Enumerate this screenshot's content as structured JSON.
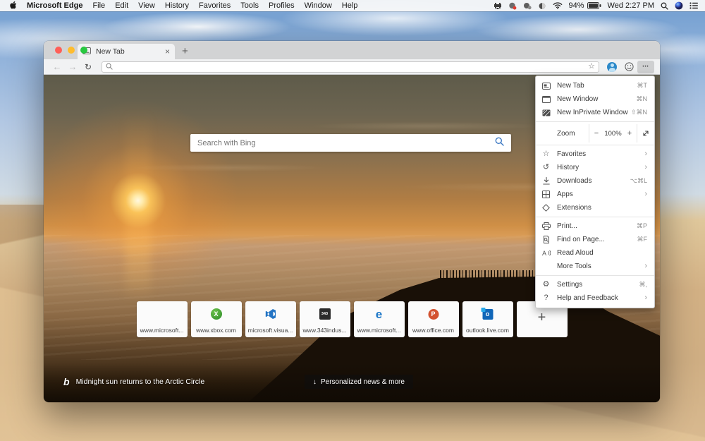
{
  "colors": {
    "accent": "#0078d4",
    "traffic_red": "#ff5f57",
    "traffic_yellow": "#febc2e",
    "traffic_green": "#28c840"
  },
  "icons": {
    "back": "←",
    "forward": "→",
    "reload": "↻",
    "star": "☆",
    "ellipsis": "•••",
    "close": "×",
    "new_tab_plus": "+",
    "add_tile_plus": "+",
    "history": "↺",
    "favorites_star": "☆",
    "gear": "⚙",
    "help": "?",
    "news_arrow": "↓",
    "bing_b": "b"
  },
  "menubar": {
    "app_name": "Microsoft Edge",
    "items": [
      "File",
      "Edit",
      "View",
      "History",
      "Favorites",
      "Tools",
      "Profiles",
      "Window",
      "Help"
    ],
    "status": {
      "battery_percent": "94%",
      "clock": "Wed 2:27 PM"
    }
  },
  "window": {
    "tab": {
      "title": "New Tab"
    },
    "address_value": ""
  },
  "edge_menu": {
    "g1": [
      {
        "label": "New Tab",
        "shortcut": "⌘T"
      },
      {
        "label": "New Window",
        "shortcut": "⌘N"
      },
      {
        "label": "New InPrivate Window",
        "shortcut": "⇧⌘N"
      }
    ],
    "zoom": {
      "label": "Zoom",
      "minus": "−",
      "value": "100%",
      "plus": "+"
    },
    "g2": [
      {
        "label": "Favorites",
        "chevron": "›"
      },
      {
        "label": "History",
        "chevron": "›"
      },
      {
        "label": "Downloads",
        "shortcut": "⌥⌘L"
      },
      {
        "label": "Apps",
        "chevron": "›"
      },
      {
        "label": "Extensions"
      }
    ],
    "g3": [
      {
        "label": "Print...",
        "shortcut": "⌘P"
      },
      {
        "label": "Find on Page...",
        "shortcut": "⌘F"
      },
      {
        "label": "Read Aloud"
      },
      {
        "label": "More Tools",
        "chevron": "›"
      }
    ],
    "g4": [
      {
        "label": "Settings",
        "shortcut": "⌘,"
      },
      {
        "label": "Help and Feedback",
        "chevron": "›"
      }
    ]
  },
  "newtab": {
    "search_placeholder": "Search with Bing",
    "tiles": [
      {
        "label": "www.microsoft..."
      },
      {
        "label": "www.xbox.com"
      },
      {
        "label": "microsoft.visua..."
      },
      {
        "label": "www.343indus..."
      },
      {
        "label": "www.microsoft..."
      },
      {
        "label": "www.office.com"
      },
      {
        "label": "outlook.live.com"
      }
    ],
    "tile_343_text": "343",
    "tile_xbox_glyph": "X",
    "tile_edge_glyph": "e",
    "tile_ppt_glyph": "P",
    "tile_outlook_glyph": "o",
    "bing_caption": "Midnight sun returns to the Arctic Circle",
    "news_button": "Personalized news & more"
  }
}
